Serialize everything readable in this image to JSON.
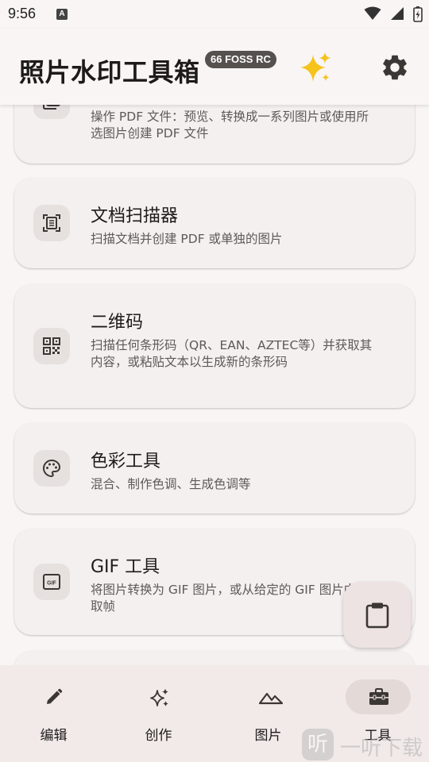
{
  "status_bar": {
    "time": "9:56",
    "notification_letter": "A"
  },
  "header": {
    "title": "照片水印工具箱",
    "version": "66 FOSS RC"
  },
  "cards": [
    {
      "id": "pdf-tools",
      "icon": "pdf-icon",
      "title": "",
      "desc": "操作 PDF 文件：预览、转换成一系列图片或使用所选图片创建 PDF 文件"
    },
    {
      "id": "document-scanner",
      "icon": "document-scanner-icon",
      "title": "文档扫描器",
      "desc": "扫描文档并创建 PDF 或单独的图片"
    },
    {
      "id": "qr-code",
      "icon": "qr-code-icon",
      "title": "二维码",
      "desc": "扫描任何条形码（QR、EAN、AZTEC等）并获取其内容，或粘贴文本以生成新的条形码"
    },
    {
      "id": "color-tools",
      "icon": "palette-icon",
      "title": "色彩工具",
      "desc": "混合、制作色调、生成色调等"
    },
    {
      "id": "gif-tools",
      "icon": "gif-icon",
      "title": "GIF 工具",
      "desc": "将图片转换为 GIF 图片，或从给定的 GIF 图片中提取帧"
    }
  ],
  "fab": {
    "icon": "clipboard-icon"
  },
  "bottom_nav": [
    {
      "label": "编辑",
      "icon": "pencil-icon",
      "active": false
    },
    {
      "label": "创作",
      "icon": "sparkles-icon",
      "active": false
    },
    {
      "label": "图片",
      "icon": "landscape-icon",
      "active": false
    },
    {
      "label": "工具",
      "icon": "toolbox-icon",
      "active": true
    }
  ],
  "watermark": {
    "icon_text": "听",
    "text": "一听下载"
  },
  "colors": {
    "background": "#f8f5f4",
    "card": "#f4f0ef",
    "nav_bg": "#f1eae8",
    "nav_active": "#e3d9d7",
    "badge": "#56514f"
  }
}
